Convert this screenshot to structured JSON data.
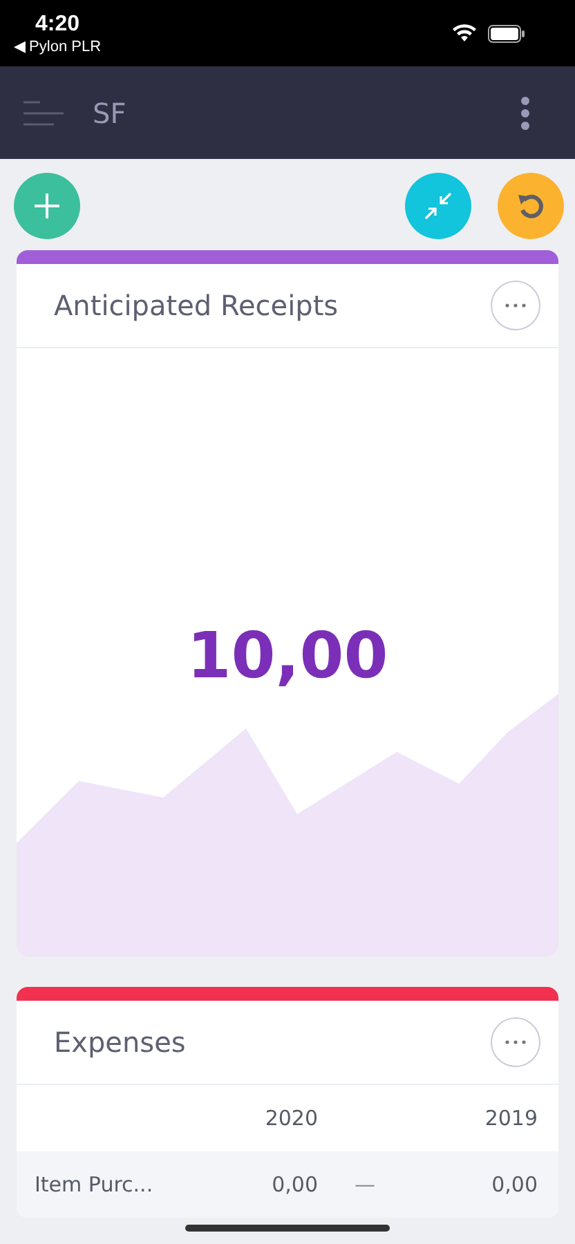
{
  "status_bar": {
    "time": "4:20",
    "back_label": "◀ Pylon PLR"
  },
  "header": {
    "title": "SF"
  },
  "cards": [
    {
      "title": "Anticipated  Receipts",
      "color": "#a05fd8",
      "kind": "kpi",
      "value": "10,00"
    },
    {
      "title": "Expenses",
      "color": "#f2304f",
      "kind": "table",
      "columns": [
        "2020",
        "2019"
      ],
      "rows": [
        {
          "label": "Item  Purc...",
          "values": [
            "0,00",
            "0,00"
          ],
          "trend": "—"
        }
      ]
    }
  ]
}
